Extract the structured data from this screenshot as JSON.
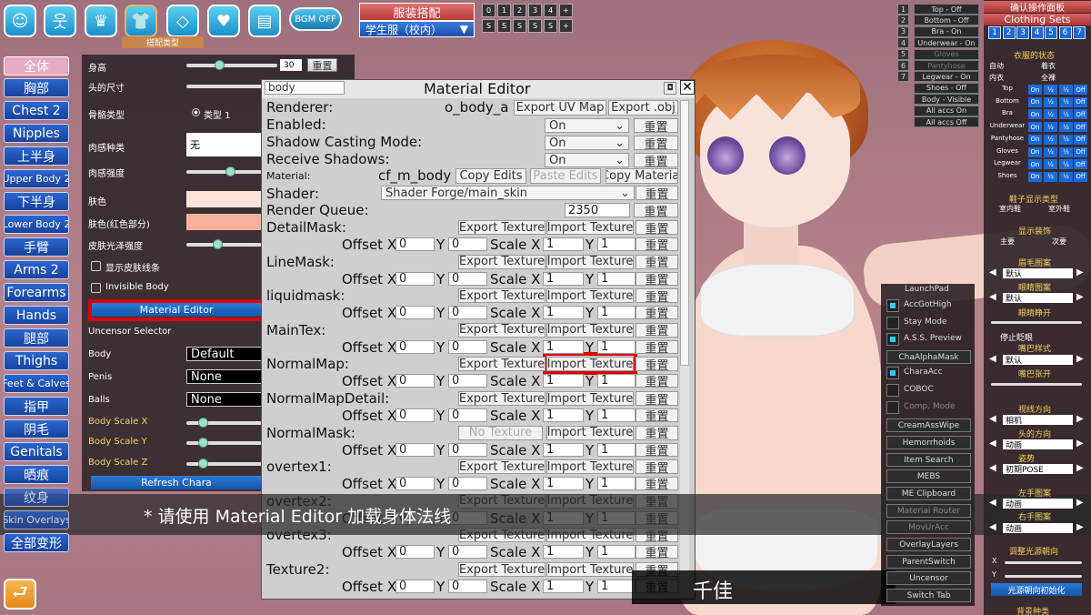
{
  "top_icons": {
    "bgm_label": "BGM OFF",
    "outfit_type_label": "搭配类型"
  },
  "categories": [
    "全体",
    "胸部",
    "Chest 2",
    "Nipples",
    "上半身",
    "Upper Body 2",
    "下半身",
    "Lower Body 2",
    "手臂",
    "Arms 2",
    "Forearms",
    "Hands",
    "腿部",
    "Thighs",
    "Feet & Calves",
    "指甲",
    "阴毛",
    "Genitals",
    "晒痕",
    "纹身",
    "Skin Overlays",
    "全部变形"
  ],
  "left_panel": {
    "height_label": "身高",
    "height_value": "30",
    "reset": "重置",
    "head_size_label": "头的尺寸",
    "skeleton_label": "骨骼类型",
    "skeleton_option": "类型 1",
    "flesh_type_label": "肉感种类",
    "flesh_type_value": "无",
    "flesh_strength_label": "肉感强度",
    "skin_color_label": "肤色",
    "skin_red_label": "肤色(红色部分)",
    "skin_gloss_label": "皮肤光泽强度",
    "show_skin_lines": "显示皮肤线条",
    "invisible_body": "Invisible Body",
    "material_editor": "Material Editor",
    "uncensor_selector": "Uncensor Selector",
    "body_label": "Body",
    "body_value": "Default",
    "penis_label": "Penis",
    "penis_value": "None",
    "balls_label": "Balls",
    "balls_value": "None",
    "body_scale_x": "Body Scale X",
    "body_scale_y": "Body Scale Y",
    "body_scale_z": "Body Scale Z",
    "refresh_chara": "Refresh Chara"
  },
  "outfit": {
    "button": "服装搭配",
    "selected": "学生服（校内）",
    "slots_row1": [
      "0",
      "1",
      "2",
      "3",
      "4",
      "+"
    ],
    "slots_row2": [
      "S",
      "S",
      "S",
      "S",
      "S",
      "+"
    ]
  },
  "material_editor": {
    "search_value": "body",
    "title": "Material Editor",
    "renderer_label": "Renderer:",
    "renderer_name": "o_body_a",
    "export_uv": "Export UV Map",
    "export_obj": "Export .obj",
    "enabled_label": "Enabled:",
    "shadow_casting_label": "Shadow Casting Mode:",
    "receive_shadows_label": "Receive Shadows:",
    "on": "On",
    "reset": "重置",
    "material_label": "Material:",
    "material_name": "cf_m_body",
    "copy_edits": "Copy Edits",
    "paste_edits": "Paste Edits",
    "copy_material": "Copy Material",
    "shader_label": "Shader:",
    "shader_value": "Shader Forge/main_skin",
    "render_queue_label": "Render Queue:",
    "render_queue_value": "2350",
    "export_texture": "Export Texture",
    "import_texture": "Import Texture",
    "no_texture": "No Texture",
    "offset_x": "Offset X",
    "y": "Y",
    "scale_x": "Scale X",
    "zero": "0",
    "one": "1",
    "textures": [
      "DetailMask:",
      "LineMask:",
      "liquidmask:",
      "MainTex:",
      "NormalMap:",
      "NormalMapDetail:",
      "NormalMask:",
      "overtex1:",
      "overtex2:",
      "overtex3:",
      "Texture2:"
    ]
  },
  "toggles": {
    "nums": [
      "1",
      "2",
      "3",
      "4",
      "5",
      "6",
      "7"
    ],
    "items": [
      "Top - Off",
      "Bottom - Off",
      "Bra - On",
      "Underwear - On",
      "Gloves",
      "Pantyhose",
      "Legwear - On",
      "Shoes - Off",
      "Body - Visible",
      "All accs On",
      "All accs Off"
    ]
  },
  "launchpad": {
    "title": "LaunchPad",
    "items": [
      "AccGotHigh",
      "Stay Mode",
      "A.S.S. Preview",
      "ChaAlphaMask",
      "CharaAcc",
      "COBOC",
      "Comp. Mode",
      "CreamAssWipe",
      "Hemorrhoids",
      "Item Search",
      "MEBS",
      "ME Clipboard",
      "Material Router",
      "MovUrAcc",
      "OverlayLayers",
      "ParentSwitch",
      "Uncensor",
      "Switch Tab"
    ]
  },
  "right_panel": {
    "confirm": "确认操作面板",
    "clothing_sets": "Clothing Sets",
    "set_nums": [
      "1",
      "2",
      "3",
      "4",
      "5",
      "6",
      "7"
    ],
    "clothes_state": "衣服的状态",
    "auto": "自动",
    "wearing": "着衣",
    "underwear": "内衣",
    "nude": "全裸",
    "rows": [
      "Top",
      "Bottom",
      "Bra",
      "Underwear",
      "Pantyhose",
      "Gloves",
      "Legwear",
      "Shoes"
    ],
    "on": "On",
    "half": "½",
    "off": "Off",
    "shoe_type": "鞋子显示类型",
    "indoor": "室内鞋",
    "outdoor": "室外鞋",
    "show_accessory": "显示装饰",
    "main": "主要",
    "sub": "次要",
    "eyebrow": "眉毛图案",
    "default": "默认",
    "eye_pattern": "眼睛图案",
    "eye_open": "眼睛睁开",
    "stop_blink": "停止眨眼",
    "mouth_style": "嘴巴样式",
    "mouth_open": "嘴巴张开",
    "gaze_dir": "视线方向",
    "camera": "相机",
    "head_dir": "头的方向",
    "animation": "动画",
    "pose": "姿势",
    "pose_value": "初期POSE",
    "left_hand": "左手图案",
    "right_hand": "右手图案",
    "light_dir": "调整光源朝向",
    "x": "X",
    "y": "Y",
    "light_reset": "光源朝向初始化",
    "bg_type": "背景种类"
  },
  "subtitle": "* 请使用 Material Editor 加载身体法线",
  "name": "千佳",
  "colors": {
    "accent_blue": "#1a6bd8",
    "highlight_red": "#e00000",
    "skin": "#fde3dc",
    "skin_red": "#f7b199"
  }
}
